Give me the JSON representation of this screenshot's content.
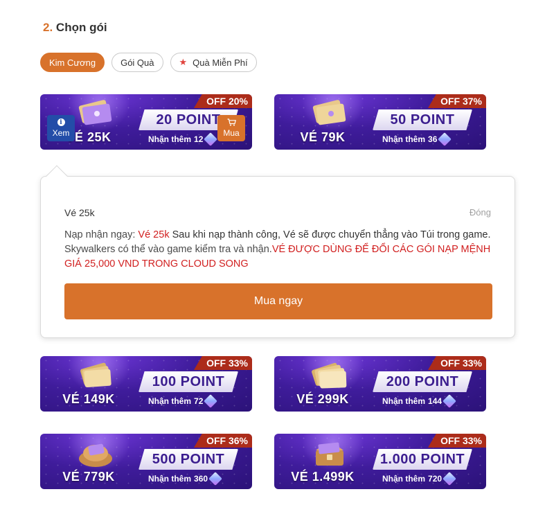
{
  "section": {
    "number": "2.",
    "title": "Chọn gói"
  },
  "tabs": [
    {
      "label": "Kim Cương",
      "active": true
    },
    {
      "label": "Gói Quà",
      "active": false
    },
    {
      "label": "Quà Miễn Phí",
      "active": false,
      "icon": "star-icon"
    }
  ],
  "cards": [
    {
      "ve": "VÉ 25K",
      "points": "20 POINT",
      "bonus_prefix": "Nhận thêm",
      "bonus": "12",
      "off": "OFF 20%",
      "selected": true
    },
    {
      "ve": "VÉ 79K",
      "points": "50 POINT",
      "bonus_prefix": "Nhận thêm",
      "bonus": "36",
      "off": "OFF 37%"
    },
    {
      "ve": "VÉ 149K",
      "points": "100 POINT",
      "bonus_prefix": "Nhận thêm",
      "bonus": "72",
      "off": "OFF 33%"
    },
    {
      "ve": "VÉ 299K",
      "points": "200 POINT",
      "bonus_prefix": "Nhận thêm",
      "bonus": "144",
      "off": "OFF 33%"
    },
    {
      "ve": "VÉ 779K",
      "points": "500 POINT",
      "bonus_prefix": "Nhận thêm",
      "bonus": "360",
      "off": "OFF 36%"
    },
    {
      "ve": "VÉ 1.499K",
      "points": "1.000 POINT",
      "bonus_prefix": "Nhận thêm",
      "bonus": "720",
      "off": "OFF 33%"
    }
  ],
  "card_actions": {
    "view": "Xem",
    "buy": "Mua"
  },
  "popup": {
    "title": "Vé 25k",
    "close": "Đóng",
    "desc_prefix": "Nạp nhận ngay: ",
    "desc_item": "Vé 25k",
    "desc_mid_strong": " Sau khi nạp thành công, Vé sẽ được chuyển thẳng vào Túi trong game.",
    "desc_mid": " Skywalkers có thể vào game kiểm tra và nhận.",
    "desc_warning": "VÉ ĐƯỢC DÙNG ĐỂ ĐỔI CÁC GÓI NẠP MỆNH GIÁ 25,000 VND TRONG CLOUD SONG",
    "buy_now": "Mua ngay"
  },
  "colors": {
    "accent": "#d8722b",
    "card_bg": "#3f1c9b",
    "off_tag": "#ac2c1a",
    "warning": "#d11f1f",
    "view_btn": "#234da8"
  }
}
